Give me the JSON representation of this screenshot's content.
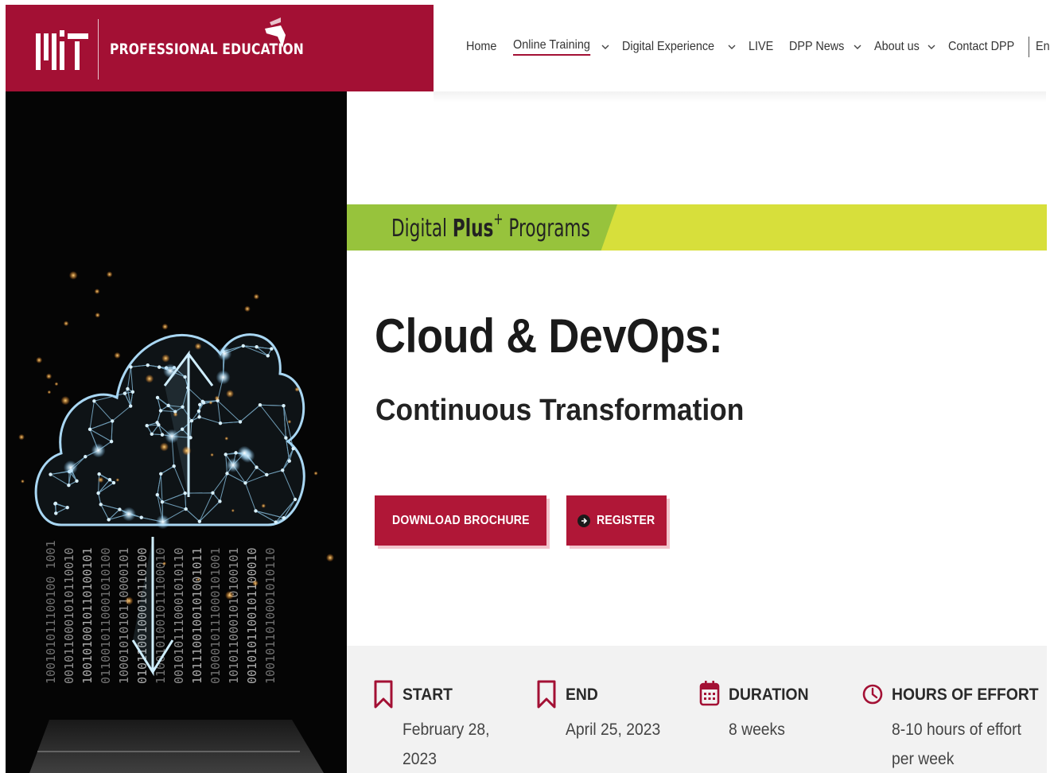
{
  "brand": {
    "name": "PROFESSIONAL EDUCATION",
    "logo_alt": "MIT",
    "color": "#a31034"
  },
  "nav": {
    "items": [
      {
        "label": "Home",
        "dropdown": false,
        "active": false
      },
      {
        "label": "Online Training",
        "dropdown": true,
        "active": true
      },
      {
        "label": "Digital Experience",
        "dropdown": true,
        "active": false
      },
      {
        "label": "LIVE",
        "dropdown": false,
        "active": false
      },
      {
        "label": "DPP News",
        "dropdown": true,
        "active": false
      },
      {
        "label": "About us",
        "dropdown": true,
        "active": false
      },
      {
        "label": "Contact DPP",
        "dropdown": false,
        "active": false
      }
    ],
    "language": "English"
  },
  "banner": {
    "prefix": "Digital",
    "bold": "Plus",
    "sup": "+",
    "suffix": "Programs",
    "colors": {
      "left": "#97c33c",
      "right": "#d7df3b"
    }
  },
  "course": {
    "title": "Cloud & DevOps:",
    "subtitle": "Continuous Transformation"
  },
  "buttons": {
    "brochure": "DOWNLOAD BROCHURE",
    "register": "REGISTER",
    "color": "#b01737"
  },
  "hero": {
    "binary_columns": [
      "100101011100100 1001",
      "0010110001010110010",
      "1001010010110100101",
      "0110010110001010100",
      "1000101010110000101",
      "0101100100010110100",
      "1100101001011100010",
      "0010101110001010110",
      "1011100100101001011",
      "0100010111000101001",
      "1010110001010100101",
      "0010101100101100010",
      "1001011010001010110"
    ]
  },
  "info": [
    {
      "icon": "bookmark-icon",
      "label": "START",
      "value": "February 28, 2023"
    },
    {
      "icon": "bookmark-icon",
      "label": "END",
      "value": "April 25, 2023"
    },
    {
      "icon": "calendar-icon",
      "label": "DURATION",
      "value": "8 weeks"
    },
    {
      "icon": "clock-icon",
      "label": "HOURS OF EFFORT",
      "value": "8-10 hours of effort per week"
    }
  ]
}
